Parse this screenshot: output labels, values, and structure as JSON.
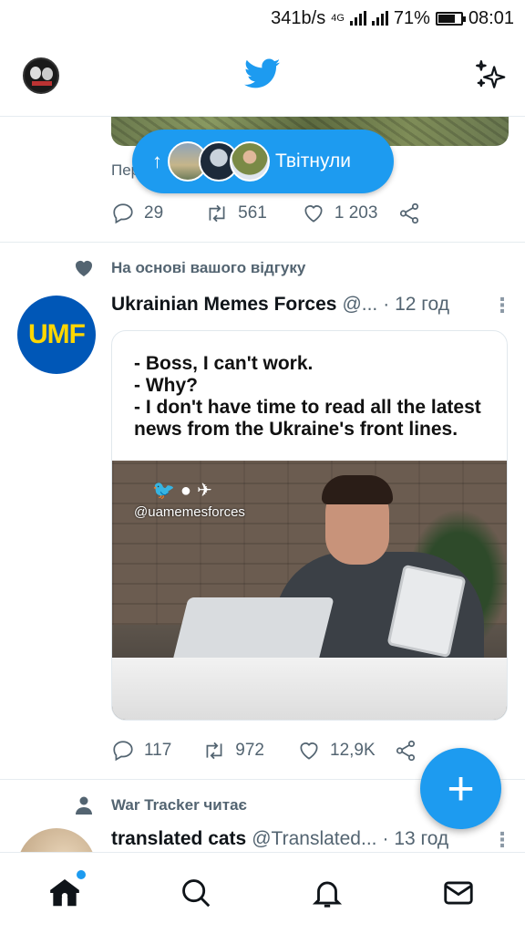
{
  "status_bar": {
    "speed": "341b/s",
    "network": "4G",
    "battery_percent": "71%",
    "time": "08:01"
  },
  "header": {
    "logo": "twitter-bird-icon",
    "sparkle": "sparkle-icon"
  },
  "previous_tweet": {
    "cut_text": "Пер",
    "replies": "29",
    "retweets": "561",
    "likes": "1 203"
  },
  "new_tweets_pill": {
    "label": "Твітнули"
  },
  "tweet1": {
    "context": "На основі вашого відгуку",
    "avatar_text": "UMF",
    "name": "Ukrainian Memes Forces",
    "handle": "@...",
    "time": "· 12 год",
    "meme_lines": [
      "- Boss, I can't work.",
      "- Why?",
      "- I don't have time to read all the latest",
      "news from the Ukraine's front lines."
    ],
    "watermark": "@uamemesforces",
    "replies": "117",
    "retweets": "972",
    "likes": "12,9K"
  },
  "tweet2": {
    "context": "War Tracker читає",
    "name": "translated cats",
    "handle": "@Translated...",
    "time": "· 13 год"
  },
  "colors": {
    "accent": "#1d9bf0",
    "muted": "#536471",
    "umf_blue": "#0057b7",
    "umf_yellow": "#ffd700"
  }
}
